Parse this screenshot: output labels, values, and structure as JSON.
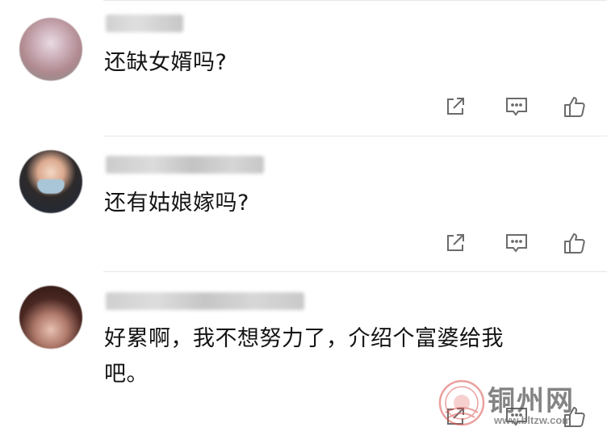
{
  "comments": [
    {
      "text": "还缺女婿吗?",
      "actions": {
        "share_icon": "share-icon",
        "reply_icon": "reply-icon",
        "like_icon": "like-icon"
      }
    },
    {
      "text": "还有姑娘嫁吗?",
      "actions": {
        "share_icon": "share-icon",
        "reply_icon": "reply-icon",
        "like_icon": "like-icon"
      }
    },
    {
      "text": "好累啊，我不想努力了，介绍个富婆给我\n吧。",
      "actions": {
        "share_icon": "share-icon",
        "reply_icon": "reply-icon",
        "like_icon": "like-icon"
      }
    }
  ],
  "watermark": {
    "name": "铜州网",
    "url": "www.bltzw.com",
    "color": "#d9534f"
  },
  "colors": {
    "icon": "#6b6b6b",
    "divider": "#e6e6e6",
    "text": "#141414"
  }
}
